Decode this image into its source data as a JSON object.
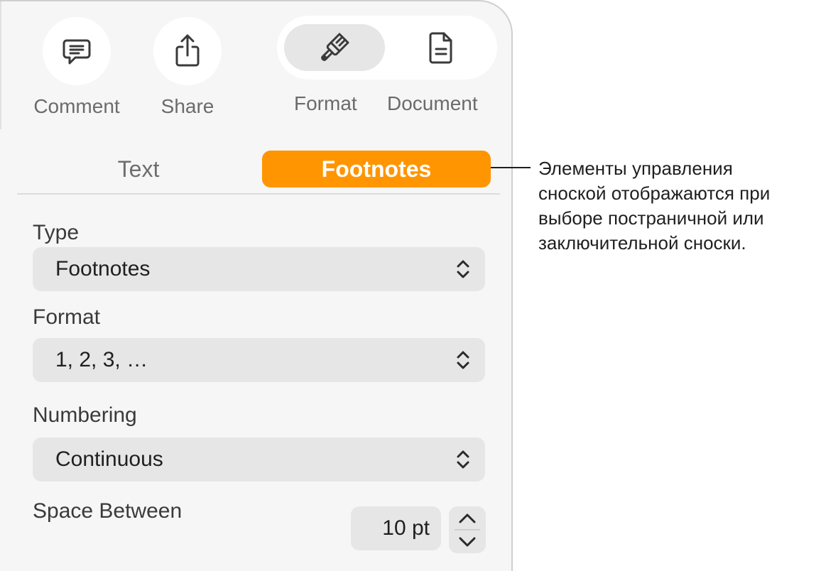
{
  "toolbar": {
    "comment_label": "Comment",
    "share_label": "Share",
    "format_label": "Format",
    "document_label": "Document",
    "icons": {
      "comment": "comment-icon",
      "share": "share-icon",
      "format": "paintbrush-icon",
      "document": "document-icon"
    }
  },
  "tabs": [
    {
      "label": "Text",
      "selected": false
    },
    {
      "label": "Footnotes",
      "selected": true
    }
  ],
  "fields": {
    "type": {
      "label": "Type",
      "value": "Footnotes"
    },
    "format": {
      "label": "Format",
      "value": "1, 2, 3, …"
    },
    "numbering": {
      "label": "Numbering",
      "value": "Continuous"
    },
    "space_between": {
      "label": "Space Between",
      "value": "10 pt"
    }
  },
  "callout": {
    "text": "Элементы управления\nсноской отображаются при\nвыборе постраничной или\nзаключительной сноски."
  },
  "colors": {
    "accent": "#ff9500",
    "panel": "#f6f6f6",
    "control": "#e6e6e6"
  }
}
